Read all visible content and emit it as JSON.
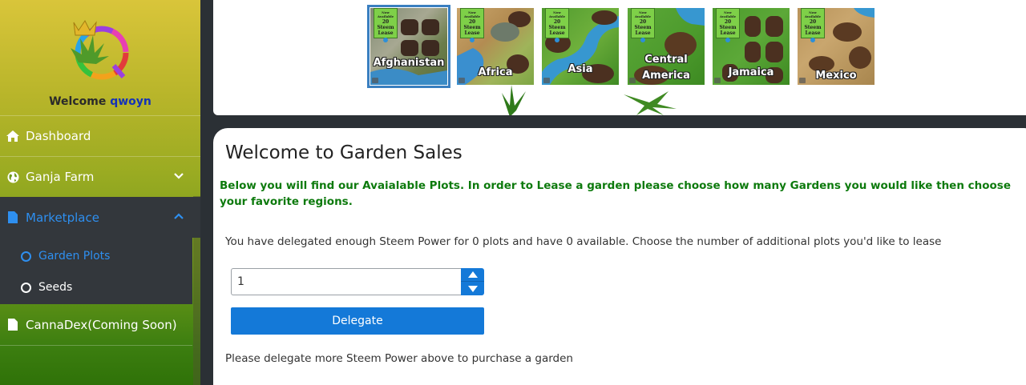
{
  "sidebar": {
    "welcome_prefix": "Welcome",
    "username": "qwoyn",
    "items": [
      {
        "label": "Dashboard",
        "icon": "home-icon"
      },
      {
        "label": "Ganja Farm",
        "icon": "globe-icon"
      },
      {
        "label": "Marketplace",
        "icon": "document-icon"
      },
      {
        "label": "CannaDex(Coming Soon)",
        "icon": "document-icon"
      }
    ],
    "submenu": [
      {
        "label": "Garden Plots",
        "icon": "circle-icon"
      },
      {
        "label": "Seeds",
        "icon": "circle-icon"
      }
    ]
  },
  "regions": [
    {
      "name": "Afghanistan",
      "tag_top": "Now Available",
      "tag_mid": "20 Steem",
      "tag_bot": "Lease",
      "selected": true
    },
    {
      "name": "Africa",
      "tag_top": "Now Available",
      "tag_mid": "20 Steem",
      "tag_bot": "Lease",
      "selected": false
    },
    {
      "name": "Asia",
      "tag_top": "Now Available",
      "tag_mid": "20 Steem",
      "tag_bot": "Lease",
      "selected": false
    },
    {
      "name": "Central America",
      "name_line1": "Central",
      "name_line2": "America",
      "tag_top": "Now Available",
      "tag_mid": "20 Steem",
      "tag_bot": "Lease",
      "selected": false
    },
    {
      "name": "Jamaica",
      "tag_top": "Now Available",
      "tag_mid": "20 Steem",
      "tag_bot": "Lease",
      "selected": false
    },
    {
      "name": "Mexico",
      "tag_top": "Now Available",
      "tag_mid": "20 Steem",
      "tag_bot": "Lease",
      "selected": false
    }
  ],
  "main": {
    "title": "Welcome to Garden Sales",
    "intro": "Below you will find our Avaialable Plots. In order to Lease a garden please choose how many Gardens you would like then choose your favorite regions.",
    "status": "You have delegated enough Steem Power for 0 plots and have 0 available. Choose the number of additional plots you'd like to lease",
    "plot_count": "1",
    "delegate_label": "Delegate",
    "footer_note": "Please delegate more Steem Power above to purchase a garden"
  },
  "colors": {
    "accent_blue": "#1479d8",
    "intro_green": "#0d7a0d",
    "username_blue": "#1432b8",
    "active_nav_blue": "#2e8ff0"
  }
}
